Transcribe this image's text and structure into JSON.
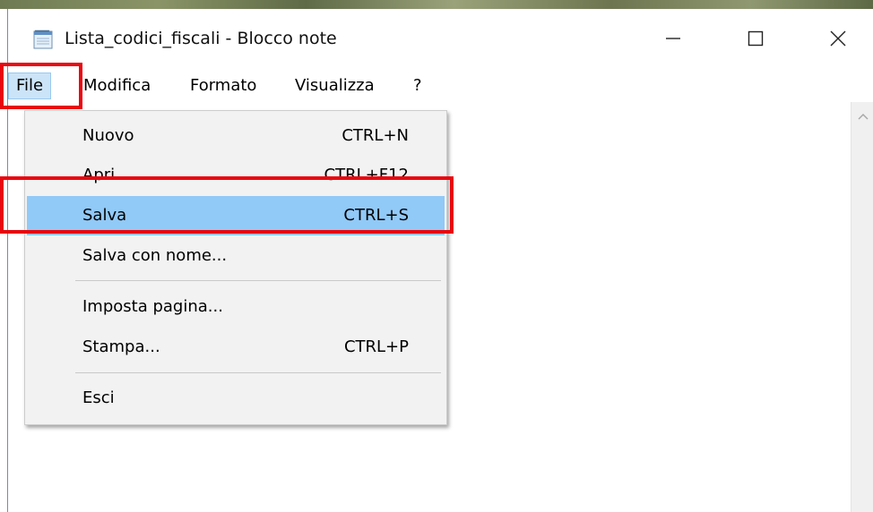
{
  "window": {
    "title": "Lista_codici_fiscali - Blocco note",
    "app_icon": "notepad-icon",
    "controls": [
      "minimize-icon",
      "maximize-icon",
      "close-icon"
    ]
  },
  "menubar": {
    "file": "File",
    "modifica": "Modifica",
    "formato": "Formato",
    "visualizza": "Visualizza",
    "help": "?"
  },
  "file_menu": {
    "items": [
      {
        "label": "Nuovo",
        "shortcut": "CTRL+N"
      },
      {
        "label": "Apri...",
        "shortcut": "CTRL+F12"
      },
      {
        "label": "Salva",
        "shortcut": "CTRL+S",
        "active": true
      },
      {
        "label": "Salva con nome...",
        "shortcut": ""
      },
      {
        "label": "Imposta pagina...",
        "shortcut": ""
      },
      {
        "label": "Stampa...",
        "shortcut": "CTRL+P"
      },
      {
        "label": "Esci",
        "shortcut": ""
      }
    ]
  },
  "colors": {
    "highlight_box": "#e8070e",
    "active_item": "#91c9f7",
    "menu_background": "#f2f2f2",
    "file_menu_pressed": "#cce4f7"
  },
  "editor": {
    "content": ""
  }
}
